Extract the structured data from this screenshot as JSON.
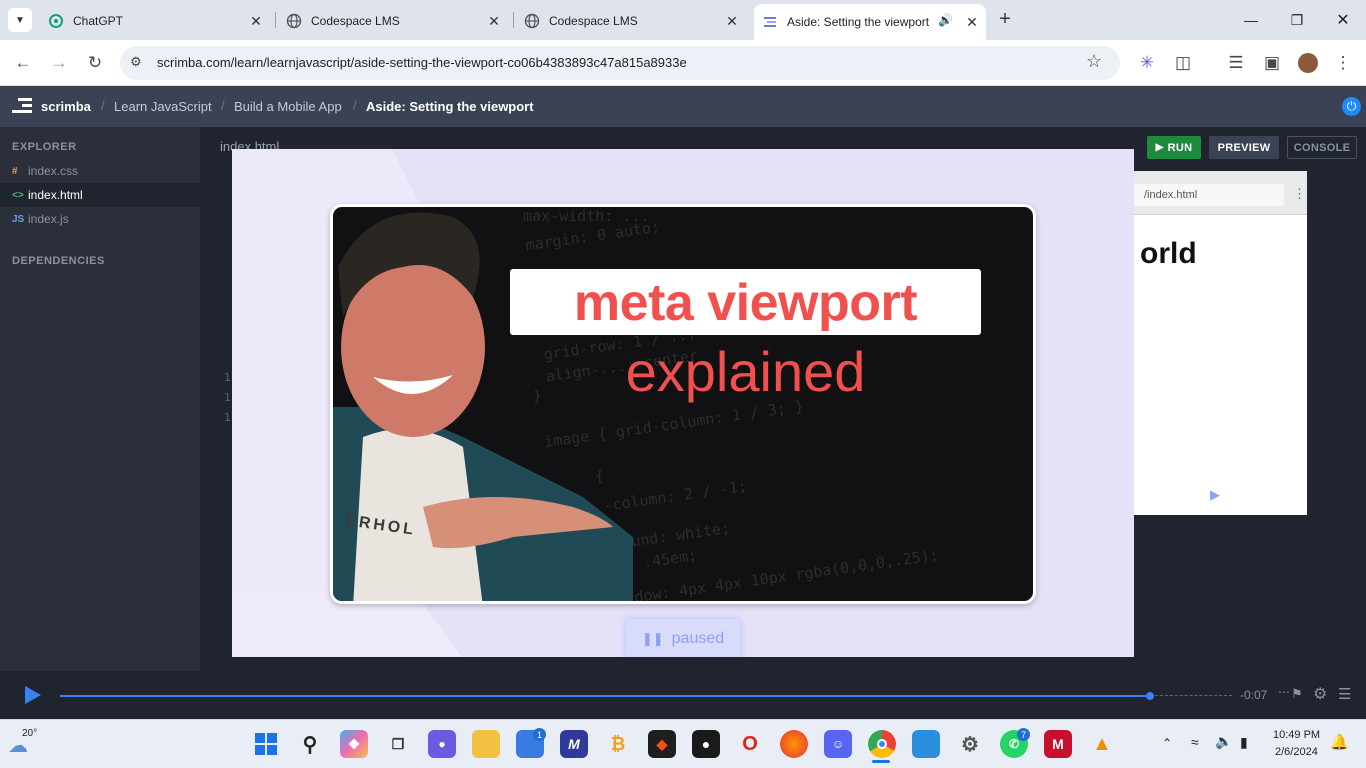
{
  "browser": {
    "tabs": [
      {
        "title": "ChatGPT",
        "icon": "chatgpt-icon"
      },
      {
        "title": "Codespace LMS",
        "icon": "globe-icon"
      },
      {
        "title": "Codespace LMS",
        "icon": "globe-icon"
      },
      {
        "title": "Aside: Setting the viewport",
        "icon": "scrimba-icon",
        "active": true,
        "audio": true
      }
    ],
    "url": "scrimba.com/learn/learnjavascript/aside-setting-the-viewport-co06b4383893c47a815a8933e"
  },
  "app": {
    "logo": "scrimba",
    "breadcrumbs": [
      "Learn JavaScript",
      "Build a Mobile App",
      "Aside: Setting the viewport"
    ]
  },
  "sidebar": {
    "explorer_label": "EXPLORER",
    "files": [
      {
        "name": "index.css",
        "icon": "#"
      },
      {
        "name": "index.html",
        "icon": "<>",
        "active": true
      },
      {
        "name": "index.js",
        "icon": "JS"
      }
    ],
    "dependencies_label": "DEPENDENCIES"
  },
  "editor": {
    "tab": "index.html",
    "line_numbers": [
      "1",
      "1",
      "1"
    ]
  },
  "panel": {
    "run": "RUN",
    "preview": "PREVIEW",
    "console": "CONSOLE",
    "preview_url": "/index.html",
    "preview_text": "orld"
  },
  "video": {
    "title_line1": "meta viewport",
    "title_line2": "explained",
    "code_lines": [
      "max-width: ...",
      "margin: 0 auto;",
      "grid-row: 1 / ...",
      "align-...: center",
      "}",
      "image { grid-column: 1 / 3; }",
      "{",
      "-column: 2 / -1;",
      "round: white;",
      ": .45em;",
      "dow: 4px 4px 10px rgba(0,0,0,.25);"
    ],
    "status": "paused",
    "shirt_text": "ERHOL"
  },
  "player": {
    "time_remaining": "-0:07",
    "progress_fraction": 0.93
  },
  "taskbar": {
    "weather_temp": "20°",
    "time": "10:49 PM",
    "date": "2/6/2024",
    "badges": {
      "store": "1",
      "whatsapp": "7"
    },
    "colors": {
      "accent": "#3b82f6",
      "run_green": "#1e8a3c",
      "title_red": "#f0514e"
    }
  }
}
